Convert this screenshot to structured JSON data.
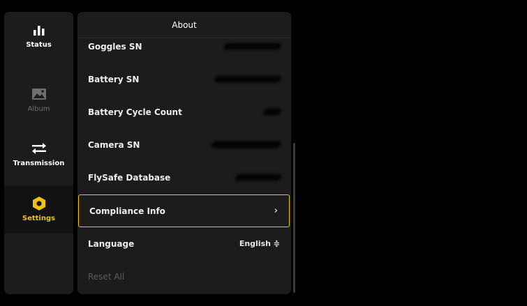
{
  "nav": {
    "items": [
      {
        "label": "Status",
        "icon": "bar-chart-icon",
        "state": "normal"
      },
      {
        "label": "Album",
        "icon": "image-icon",
        "state": "disabled"
      },
      {
        "label": "Transmission",
        "icon": "transfer-arrows-icon",
        "state": "normal"
      },
      {
        "label": "Settings",
        "icon": "hex-gear-icon",
        "state": "active"
      }
    ]
  },
  "panel": {
    "title": "About",
    "rows": [
      {
        "label": "Goggles SN",
        "value": ""
      },
      {
        "label": "Battery SN",
        "value": ""
      },
      {
        "label": "Battery Cycle Count",
        "value": ""
      },
      {
        "label": "Camera SN",
        "value": ""
      },
      {
        "label": "FlySafe Database",
        "value": ""
      },
      {
        "label": "Compliance Info",
        "value": "",
        "chevron": "›"
      },
      {
        "label": "Language",
        "value": "English ≑"
      },
      {
        "label": "Reset All",
        "value": ""
      }
    ]
  },
  "colors": {
    "accent": "#f2c10f",
    "panel": "#1c1c1c",
    "background": "#000000"
  }
}
